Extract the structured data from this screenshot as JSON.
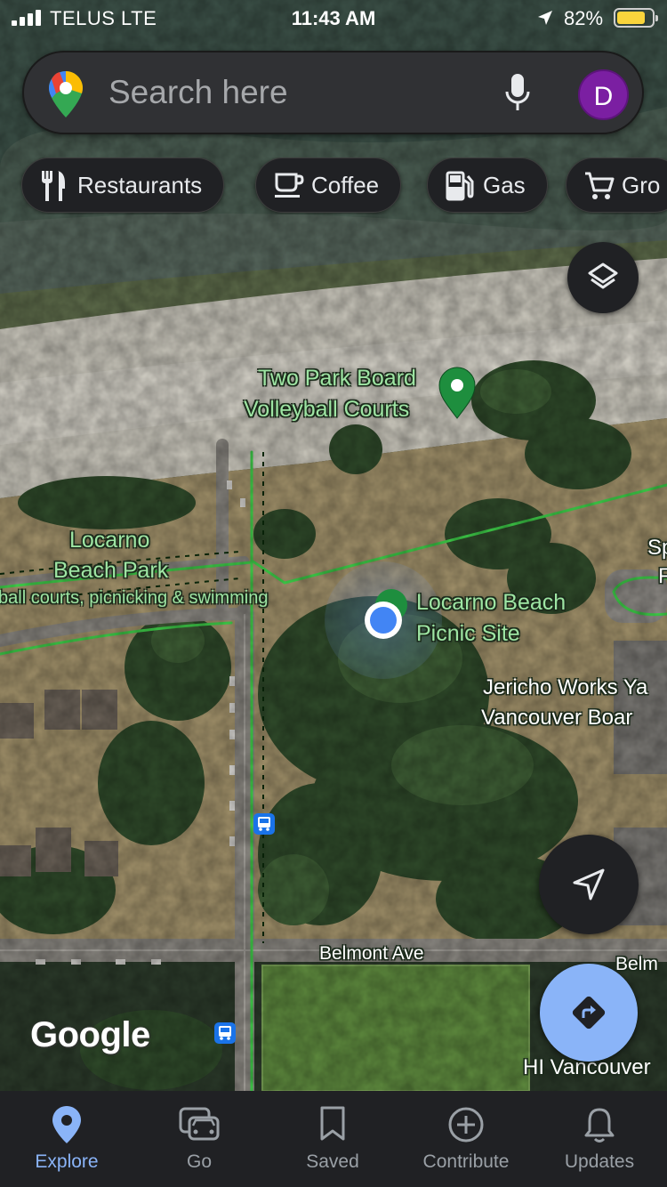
{
  "status_bar": {
    "carrier": "TELUS  LTE",
    "time": "11:43 AM",
    "battery": "82%",
    "battery_level": 0.82
  },
  "search": {
    "placeholder": "Search here",
    "avatar_letter": "D"
  },
  "chips": [
    {
      "label": "Restaurants",
      "icon": "fork-knife-icon"
    },
    {
      "label": "Coffee",
      "icon": "coffee-cup-icon"
    },
    {
      "label": "Gas",
      "icon": "gas-pump-icon"
    },
    {
      "label": "Gro",
      "icon": "shopping-cart-icon"
    }
  ],
  "map": {
    "view": "satellite",
    "labels": {
      "volleyball_1": "Two Park Board",
      "volleyball_2": "Volleyball Courts",
      "locarno_park_1": "Locarno",
      "locarno_park_2": "Beach Park",
      "park_desc": "ball courts, picnicking & swimming",
      "picnic_1": "Locarno Beach",
      "picnic_2": "Picnic Site",
      "jericho_1": "Jericho Works Ya",
      "jericho_2": "Vancouver Boar",
      "sp_1": "Sp",
      "sp_2": "F",
      "belmont": "Belmont Ave",
      "belm_right": "Belm",
      "hi_vancouver": "HI Vancouver"
    },
    "attribution": "Google"
  },
  "nav": [
    {
      "label": "Explore",
      "icon": "map-pin-icon",
      "active": true
    },
    {
      "label": "Go",
      "icon": "car-icon",
      "active": false
    },
    {
      "label": "Saved",
      "icon": "bookmark-icon",
      "active": false
    },
    {
      "label": "Contribute",
      "icon": "plus-circle-icon",
      "active": false
    },
    {
      "label": "Updates",
      "icon": "bell-icon",
      "active": false
    }
  ],
  "colors": {
    "accent": "#8ab4f8",
    "route_green": "#3fd14a",
    "label_green": "#9ee5a3",
    "avatar": "#7b1fa2",
    "battery": "#f9d53c"
  }
}
